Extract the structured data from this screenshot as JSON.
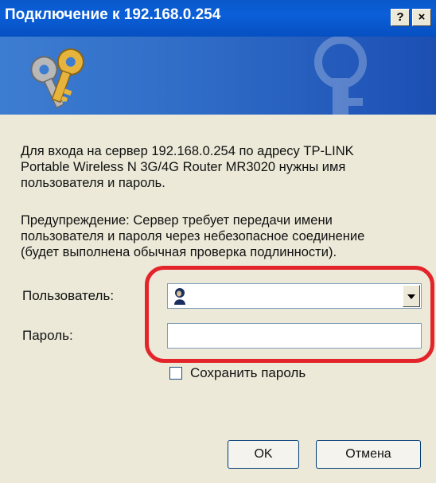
{
  "dialog": {
    "title": "Подключение к 192.168.0.254",
    "help_button": "?",
    "close_button": "×",
    "message": [
      "Для входа на сервер 192.168.0.254 по адресу TP-LINK",
      "Portable Wireless N 3G/4G Router MR3020 нужны имя",
      "пользователя и пароль."
    ],
    "warning": [
      "Предупреждение: Сервер требует передачи имени",
      "пользователя и пароля через небезопасное соединение",
      "(будет выполнена обычная проверка подлинности)."
    ],
    "username_label": "Пользователь:",
    "username_value": "",
    "password_label": "Пароль:",
    "password_value": "",
    "remember_label": "Сохранить пароль",
    "remember_checked": false,
    "ok_label": "OK",
    "cancel_label": "Отмена",
    "highlight_color": "#e3242b",
    "titlebar_color": "#0a58c9"
  }
}
